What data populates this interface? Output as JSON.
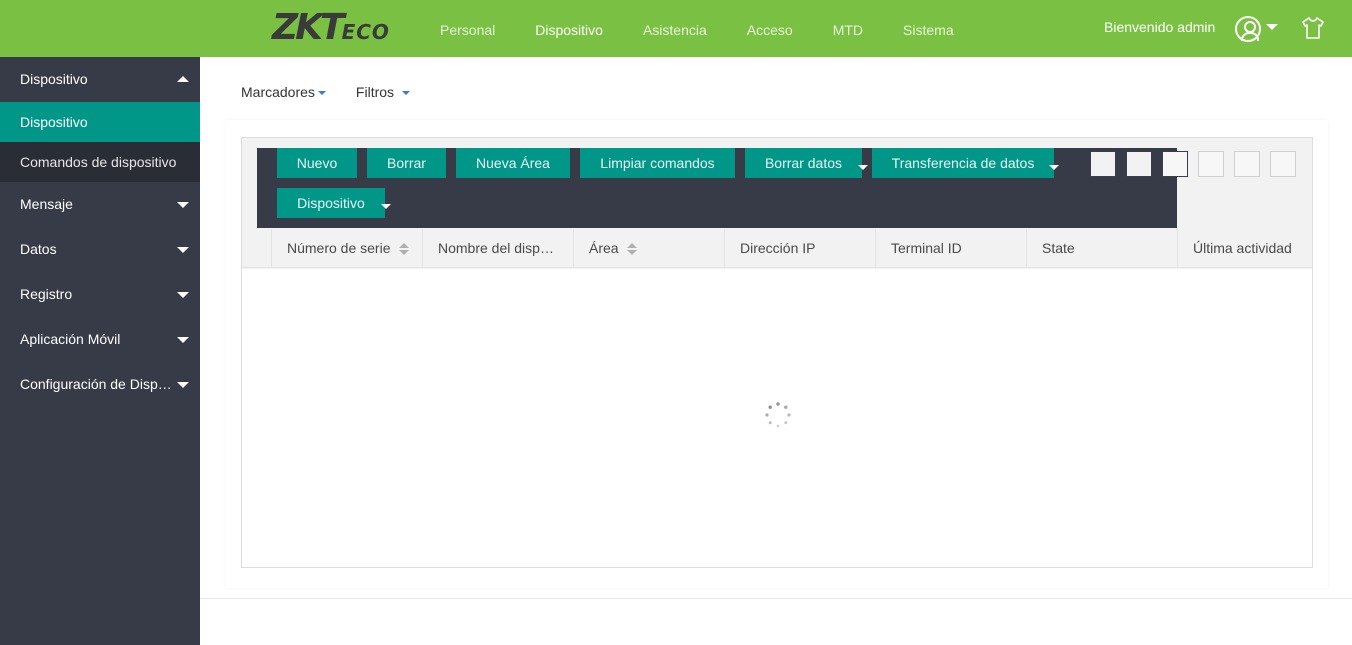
{
  "brand": {
    "logo_main": "ZKT",
    "logo_sub": "ECO"
  },
  "nav": {
    "items": [
      {
        "label": "Personal"
      },
      {
        "label": "Dispositivo"
      },
      {
        "label": "Asistencia"
      },
      {
        "label": "Acceso"
      },
      {
        "label": "MTD"
      },
      {
        "label": "Sistema"
      }
    ],
    "active_index": 1,
    "welcome": "Bienvenido admin"
  },
  "sidebar": {
    "section_title": "Dispositivo",
    "sub_items": [
      {
        "label": "Dispositivo"
      },
      {
        "label": "Comandos de dispositivo"
      }
    ],
    "groups": [
      {
        "label": "Mensaje"
      },
      {
        "label": "Datos"
      },
      {
        "label": "Registro"
      },
      {
        "label": "Aplicación Móvil"
      },
      {
        "label": "Configuración de Dispositivo"
      }
    ]
  },
  "filters": {
    "bookmarks": "Marcadores",
    "filters": "Filtros"
  },
  "toolbar": {
    "new": "Nuevo",
    "delete": "Borrar",
    "new_area": "Nueva Área",
    "clear_commands": "Limpiar comandos",
    "clear_data": "Borrar datos",
    "data_transfer": "Transferencia de datos",
    "device": "Dispositivo"
  },
  "table": {
    "columns": [
      {
        "label": "Número de serie",
        "sortable": true
      },
      {
        "label": "Nombre del dispositivo",
        "sortable": false
      },
      {
        "label": "Área",
        "sortable": true
      },
      {
        "label": "Dirección IP",
        "sortable": false
      },
      {
        "label": "Terminal ID",
        "sortable": false
      },
      {
        "label": "State",
        "sortable": false
      },
      {
        "label": "Última actividad",
        "sortable": false
      }
    ],
    "rows": [],
    "loading": true
  },
  "colors": {
    "topbar": "#7ac143",
    "sidebar": "#373a47",
    "accent": "#009688"
  }
}
